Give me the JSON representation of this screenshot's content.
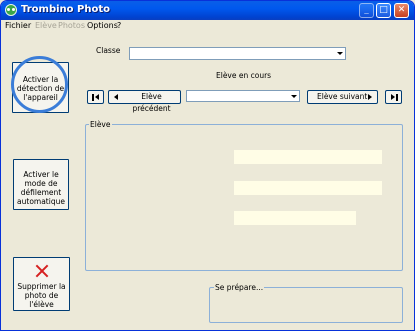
{
  "window": {
    "title": "Trombino Photo",
    "controls": {
      "minimize": "_",
      "maximize": "□",
      "close": "✕"
    }
  },
  "menu": {
    "items": [
      {
        "label": "Fichier",
        "enabled": true
      },
      {
        "label": "Elève",
        "enabled": false
      },
      {
        "label": "Photos",
        "enabled": false
      },
      {
        "label": "Options",
        "enabled": true
      },
      {
        "label": "?",
        "enabled": true
      }
    ]
  },
  "left_panel": {
    "detect_button": {
      "lines": [
        "Activer la",
        "détection de",
        "l'appareil"
      ]
    },
    "scroll_button": {
      "lines": [
        "Activer le",
        "mode de",
        "défilement",
        "automatique"
      ]
    },
    "delete_button": {
      "lines": [
        "Supprimer la",
        "photo de",
        "l'élève"
      ],
      "icon": "delete-x-icon"
    }
  },
  "classe": {
    "label": "Classe",
    "value": ""
  },
  "current_student": {
    "label": "Elève en cours",
    "first_label": "",
    "prev_label": "Elève précédent",
    "select_value": "",
    "next_label": "Elève suivant",
    "last_label": ""
  },
  "eleve_group": {
    "title": "Elève",
    "fields": [
      "",
      "",
      ""
    ]
  },
  "status_group": {
    "title": "Se prépare..."
  },
  "colors": {
    "titlebar": "#0058ee",
    "window_bg": "#ece9d8",
    "field_bg": "#fffde6",
    "focus_ring": "#3b7dd8",
    "delete_icon": "#d62020"
  }
}
